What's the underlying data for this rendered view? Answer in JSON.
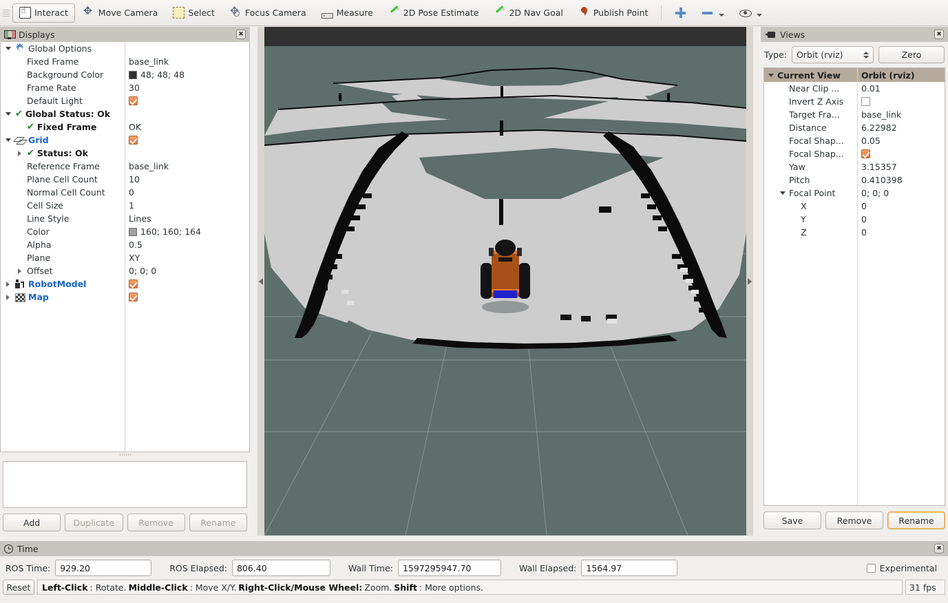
{
  "toolbar": {
    "tools": [
      {
        "label": "Interact",
        "icon": "hand-icon",
        "active": true
      },
      {
        "label": "Move Camera",
        "icon": "move-camera-icon",
        "active": false
      },
      {
        "label": "Select",
        "icon": "select-icon",
        "active": false
      },
      {
        "label": "Focus Camera",
        "icon": "focus-camera-icon",
        "active": false
      },
      {
        "label": "Measure",
        "icon": "ruler-icon",
        "active": false
      },
      {
        "label": "2D Pose Estimate",
        "icon": "pen-icon",
        "active": false
      },
      {
        "label": "2D Nav Goal",
        "icon": "pen-icon",
        "active": false
      },
      {
        "label": "Publish Point",
        "icon": "map-pin-icon",
        "active": false
      }
    ],
    "extra_icons": [
      "plus-icon",
      "minus-icon",
      "chevron-down-icon",
      "eye-icon",
      "chevron-down-icon"
    ]
  },
  "displays": {
    "title": "Displays",
    "close_label": "✖",
    "tree": [
      {
        "indent": 0,
        "twisty": "down",
        "icon": "gear-icon",
        "label": "Global Options",
        "style": "plain",
        "value": "",
        "value_type": "none"
      },
      {
        "indent": 1,
        "twisty": "none",
        "icon": "none",
        "label": "Fixed Frame",
        "style": "plain",
        "value": "base_link",
        "value_type": "text"
      },
      {
        "indent": 1,
        "twisty": "none",
        "icon": "none",
        "label": "Background Color",
        "style": "plain",
        "value": "48; 48; 48",
        "value_type": "color",
        "swatch": "#303030"
      },
      {
        "indent": 1,
        "twisty": "none",
        "icon": "none",
        "label": "Frame Rate",
        "style": "plain",
        "value": "30",
        "value_type": "text"
      },
      {
        "indent": 1,
        "twisty": "none",
        "icon": "none",
        "label": "Default Light",
        "style": "plain",
        "value": "",
        "value_type": "checked"
      },
      {
        "indent": 0,
        "twisty": "down",
        "icon": "check-icon",
        "label": "Global Status: Ok",
        "style": "bold",
        "value": "",
        "value_type": "none"
      },
      {
        "indent": 1,
        "twisty": "none",
        "icon": "check-icon",
        "label": "Fixed Frame",
        "style": "bold",
        "value": "OK",
        "value_type": "text"
      },
      {
        "indent": 0,
        "twisty": "down",
        "icon": "grid-icon",
        "label": "Grid",
        "style": "blue",
        "value": "",
        "value_type": "checked"
      },
      {
        "indent": 1,
        "twisty": "right",
        "icon": "check-icon",
        "label": "Status: Ok",
        "style": "bold",
        "value": "",
        "value_type": "none"
      },
      {
        "indent": 1,
        "twisty": "none",
        "icon": "none",
        "label": "Reference Frame",
        "style": "plain",
        "value": "base_link",
        "value_type": "text"
      },
      {
        "indent": 1,
        "twisty": "none",
        "icon": "none",
        "label": "Plane Cell Count",
        "style": "plain",
        "value": "10",
        "value_type": "text"
      },
      {
        "indent": 1,
        "twisty": "none",
        "icon": "none",
        "label": "Normal Cell Count",
        "style": "plain",
        "value": "0",
        "value_type": "text"
      },
      {
        "indent": 1,
        "twisty": "none",
        "icon": "none",
        "label": "Cell Size",
        "style": "plain",
        "value": "1",
        "value_type": "text"
      },
      {
        "indent": 1,
        "twisty": "none",
        "icon": "none",
        "label": "Line Style",
        "style": "plain",
        "value": "Lines",
        "value_type": "text"
      },
      {
        "indent": 1,
        "twisty": "none",
        "icon": "none",
        "label": "Color",
        "style": "plain",
        "value": "160; 160; 164",
        "value_type": "color",
        "swatch": "#a0a0a4"
      },
      {
        "indent": 1,
        "twisty": "none",
        "icon": "none",
        "label": "Alpha",
        "style": "plain",
        "value": "0.5",
        "value_type": "text"
      },
      {
        "indent": 1,
        "twisty": "none",
        "icon": "none",
        "label": "Plane",
        "style": "plain",
        "value": "XY",
        "value_type": "text"
      },
      {
        "indent": 1,
        "twisty": "right",
        "icon": "none",
        "label": "Offset",
        "style": "plain",
        "value": "0; 0; 0",
        "value_type": "text"
      },
      {
        "indent": 0,
        "twisty": "right",
        "icon": "robot-icon",
        "label": "RobotModel",
        "style": "blue",
        "value": "",
        "value_type": "checked"
      },
      {
        "indent": 0,
        "twisty": "right",
        "icon": "map-icon",
        "label": "Map",
        "style": "blue",
        "value": "",
        "value_type": "checked"
      }
    ],
    "buttons": [
      {
        "label": "Add",
        "enabled": true
      },
      {
        "label": "Duplicate",
        "enabled": false
      },
      {
        "label": "Remove",
        "enabled": false
      },
      {
        "label": "Rename",
        "enabled": false
      }
    ]
  },
  "views": {
    "title": "Views",
    "close_label": "✖",
    "type_label": "Type:",
    "type_value": "Orbit (rviz)",
    "zero_label": "Zero",
    "tree": [
      {
        "indent": 0,
        "twisty": "down",
        "label": "Current View",
        "value": "Orbit (rviz)",
        "header": true,
        "value_type": "text"
      },
      {
        "indent": 1,
        "twisty": "none",
        "label": "Near Clip ...",
        "value": "0.01",
        "header": false,
        "value_type": "text"
      },
      {
        "indent": 1,
        "twisty": "none",
        "label": "Invert Z Axis",
        "value": "",
        "header": false,
        "value_type": "unchecked"
      },
      {
        "indent": 1,
        "twisty": "none",
        "label": "Target Fra...",
        "value": "base_link",
        "header": false,
        "value_type": "text"
      },
      {
        "indent": 1,
        "twisty": "none",
        "label": "Distance",
        "value": "6.22982",
        "header": false,
        "value_type": "text"
      },
      {
        "indent": 1,
        "twisty": "none",
        "label": "Focal Shap...",
        "value": "0.05",
        "header": false,
        "value_type": "text"
      },
      {
        "indent": 1,
        "twisty": "none",
        "label": "Focal Shap...",
        "value": "",
        "header": false,
        "value_type": "checked"
      },
      {
        "indent": 1,
        "twisty": "none",
        "label": "Yaw",
        "value": "3.15357",
        "header": false,
        "value_type": "text"
      },
      {
        "indent": 1,
        "twisty": "none",
        "label": "Pitch",
        "value": "0.410398",
        "header": false,
        "value_type": "text"
      },
      {
        "indent": 1,
        "twisty": "down",
        "label": "Focal Point",
        "value": "0; 0; 0",
        "header": false,
        "value_type": "text"
      },
      {
        "indent": 2,
        "twisty": "none",
        "label": "X",
        "value": "0",
        "header": false,
        "value_type": "text"
      },
      {
        "indent": 2,
        "twisty": "none",
        "label": "Y",
        "value": "0",
        "header": false,
        "value_type": "text"
      },
      {
        "indent": 2,
        "twisty": "none",
        "label": "Z",
        "value": "0",
        "header": false,
        "value_type": "text"
      }
    ],
    "buttons": [
      {
        "label": "Save",
        "focus": false
      },
      {
        "label": "Remove",
        "focus": false
      },
      {
        "label": "Rename",
        "focus": true
      }
    ]
  },
  "time": {
    "title": "Time",
    "close_label": "✖",
    "fields": [
      {
        "label": "ROS Time:",
        "value": "929.20"
      },
      {
        "label": "ROS Elapsed:",
        "value": "806.40"
      },
      {
        "label": "Wall Time:",
        "value": "1597295947.70"
      },
      {
        "label": "Wall Elapsed:",
        "value": "1564.97"
      }
    ],
    "experimental_label": "Experimental",
    "experimental_checked": false
  },
  "statusbar": {
    "reset_label": "Reset",
    "hint_segments": [
      {
        "text": "Left-Click",
        "bold": true
      },
      {
        "text": ": Rotate. ",
        "bold": false
      },
      {
        "text": "Middle-Click",
        "bold": true
      },
      {
        "text": ": Move X/Y. ",
        "bold": false
      },
      {
        "text": "Right-Click/Mouse Wheel:",
        "bold": true
      },
      {
        "text": " Zoom. ",
        "bold": false
      },
      {
        "text": "Shift",
        "bold": true
      },
      {
        "text": ": More options.",
        "bold": false
      }
    ],
    "fps": "31 fps"
  },
  "viewport": {
    "background_color": "#5d6e6b",
    "top_band_color": "#303030",
    "free_space_color": "#cdcdcd",
    "occupied_color": "#000000",
    "grid_line_color": "#a0a0a4",
    "robot": {
      "body_color": "#a8501a",
      "wheel_color": "#1a1a1a",
      "sensor_color": "#141414",
      "front_color": "#2222cc",
      "trim_color": "#e07b2a"
    }
  }
}
